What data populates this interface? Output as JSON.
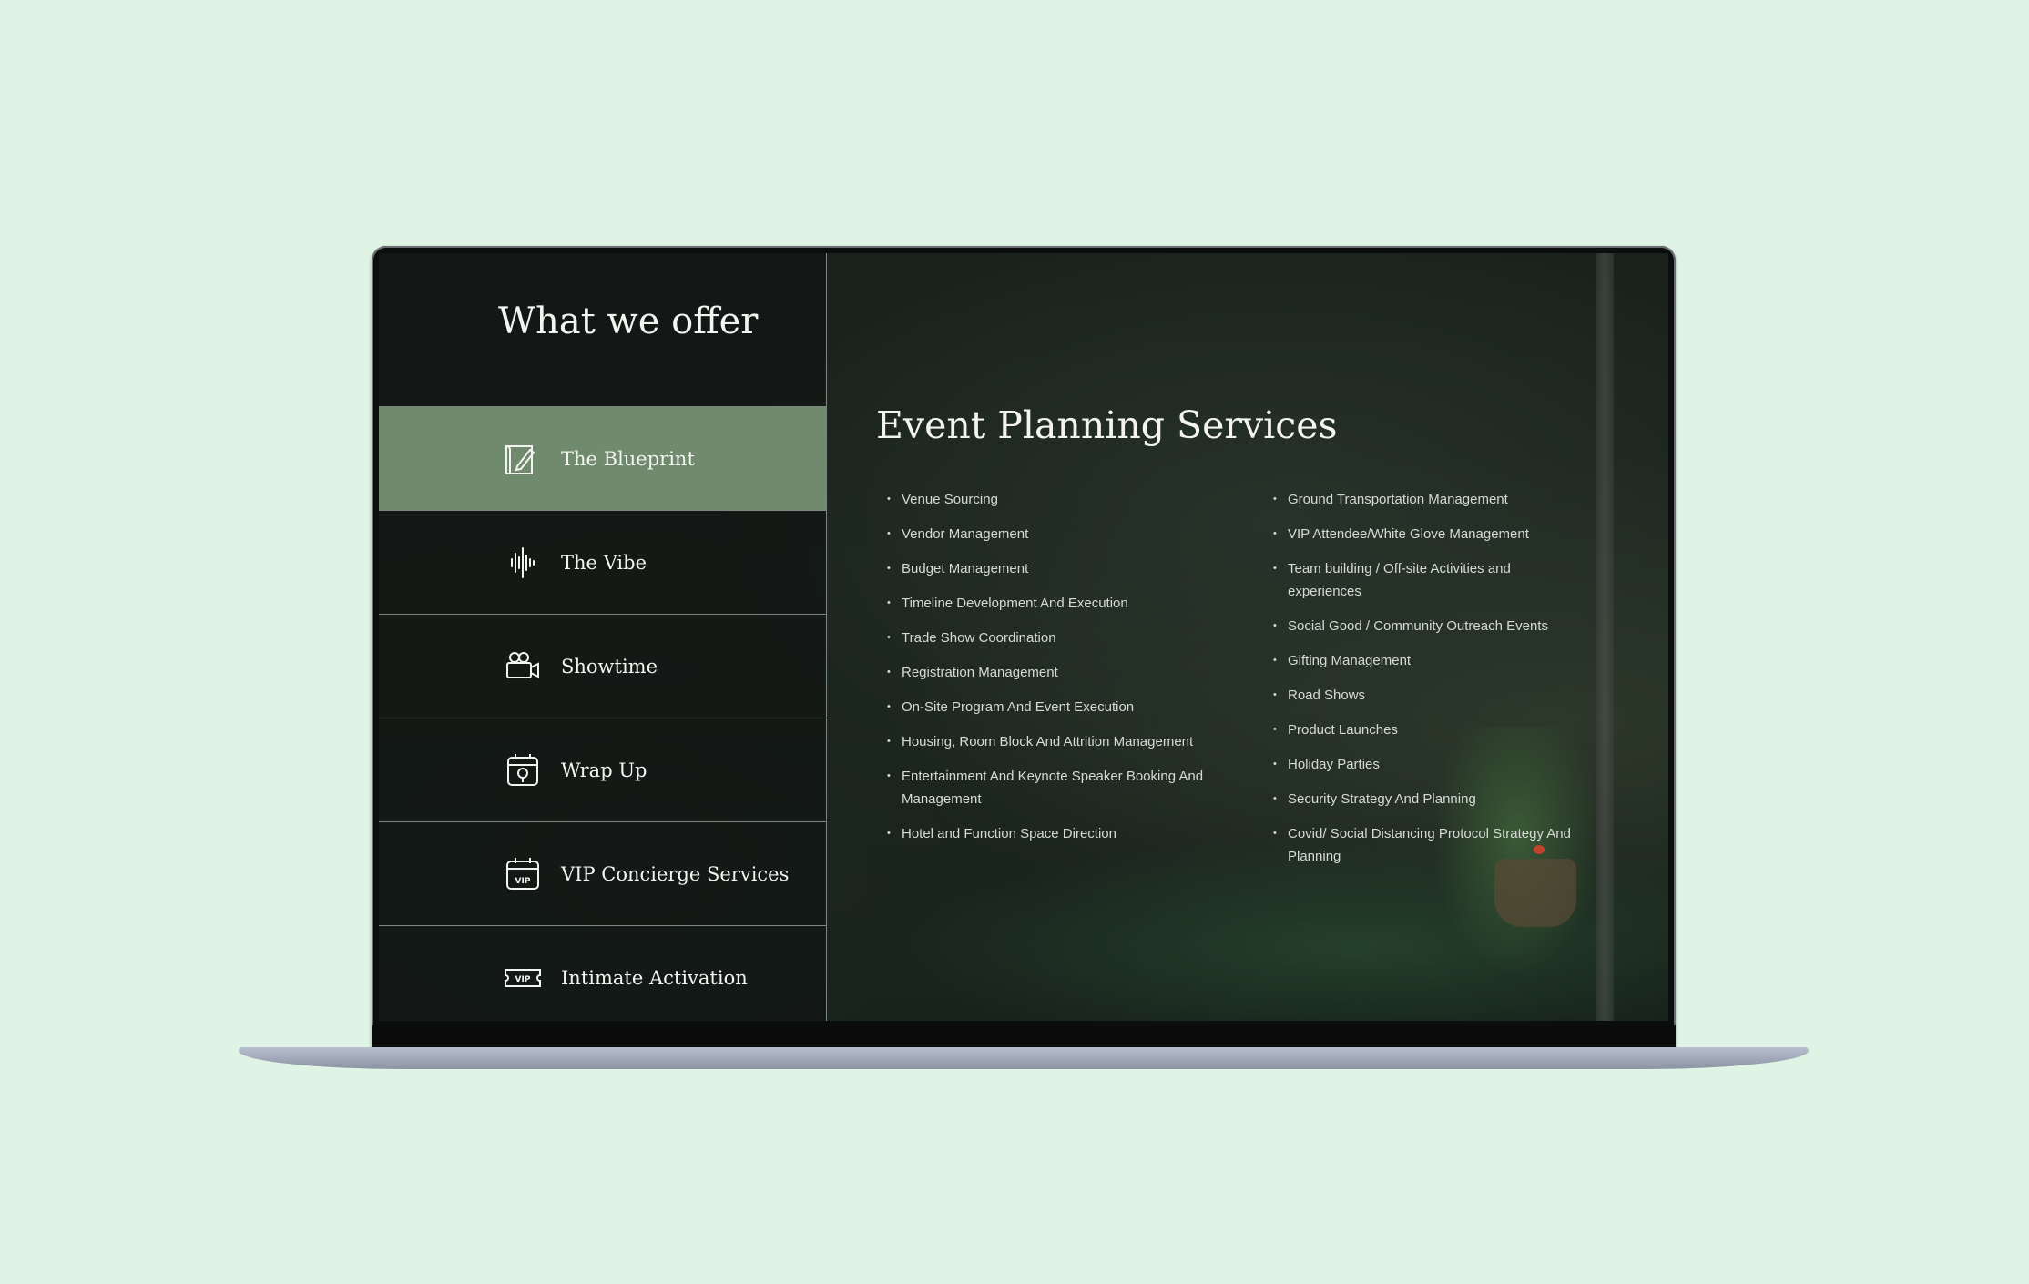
{
  "sidebar": {
    "title": "What we offer",
    "items": [
      {
        "label": "The Blueprint",
        "icon": "blueprint-icon",
        "active": true
      },
      {
        "label": "The Vibe",
        "icon": "soundwave-icon",
        "active": false
      },
      {
        "label": "Showtime",
        "icon": "video-camera-icon",
        "active": false
      },
      {
        "label": "Wrap Up",
        "icon": "calendar-check-icon",
        "active": false
      },
      {
        "label": "VIP Concierge Services",
        "icon": "vip-calendar-icon",
        "active": false
      },
      {
        "label": "Intimate Activation",
        "icon": "vip-ticket-icon",
        "active": false
      }
    ]
  },
  "main": {
    "title": "Event Planning Services",
    "column1": [
      "Venue Sourcing",
      "Vendor Management",
      "Budget Management",
      "Timeline Development And Execution",
      "Trade Show Coordination",
      "Registration Management",
      "On-Site Program And Event Execution",
      "Housing, Room Block And Attrition Management",
      "Entertainment And Keynote Speaker Booking And Management",
      "Hotel and Function Space Direction"
    ],
    "column2": [
      "Ground Transportation Management",
      "VIP Attendee/White Glove Management",
      "Team building / Off-site Activities and experiences",
      "Social Good / Community Outreach Events",
      "Gifting Management",
      "Road Shows",
      "Product Launches",
      "Holiday Parties",
      "Security Strategy And Planning",
      "Covid/ Social Distancing Protocol Strategy And Planning"
    ]
  },
  "colors": {
    "page_background": "#dff4e4",
    "active_menu": "#6f8a6c",
    "text": "#f3f3ef"
  }
}
